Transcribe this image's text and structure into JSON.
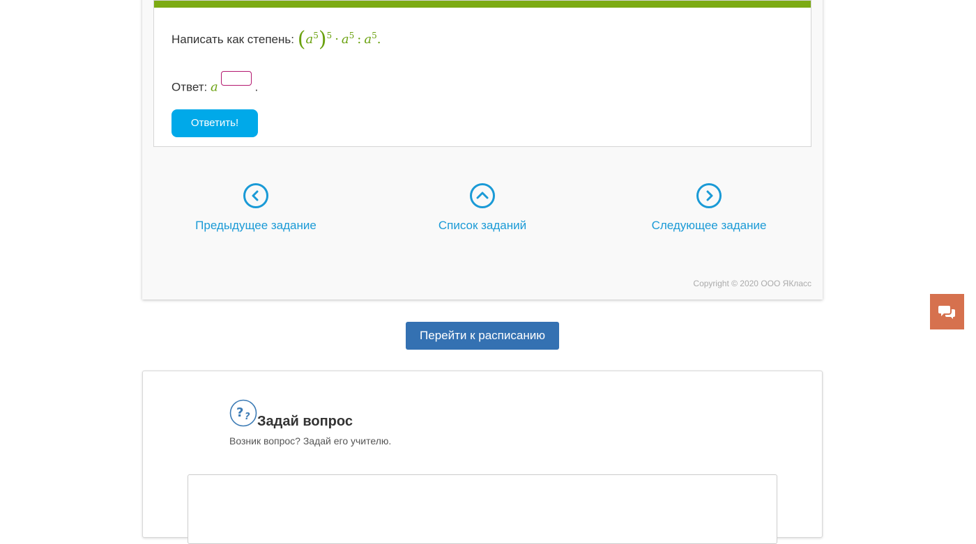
{
  "task": {
    "prompt": "Написать как степень:",
    "expr": {
      "base1": "a",
      "inner_exp": "5",
      "outer_exp": "5",
      "op1": "·",
      "base2": "a",
      "exp2": "5",
      "op2": ":",
      "base3": "a",
      "exp3": "5",
      "end": "."
    },
    "answer_label": "Ответ:",
    "answer_base": "a",
    "answer_value": "",
    "answer_end": ".",
    "submit_label": "Ответить!"
  },
  "nav": {
    "prev": "Предыдущее задание",
    "list": "Список заданий",
    "next": "Следующее задание"
  },
  "copyright": "Copyright © 2020 ООО ЯКласс",
  "schedule_button": "Перейти к расписанию",
  "question": {
    "title": "Задай вопрос",
    "subtitle": "Возник вопрос? Задай его учителю.",
    "textarea_value": ""
  },
  "icons": {
    "prev": "chevron-left-icon",
    "list": "chevron-up-icon",
    "next": "chevron-right-icon",
    "chat": "chat-bubbles-icon",
    "question": "question-marks-icon"
  },
  "colors": {
    "green_accent": "#7cab13",
    "math_green": "#6aa10f",
    "link_blue": "#1a9ad6",
    "submit_blue": "#00a9e9",
    "schedule_blue": "#3471b2",
    "chat_orange": "#d6714e",
    "input_border": "#b3176f"
  }
}
